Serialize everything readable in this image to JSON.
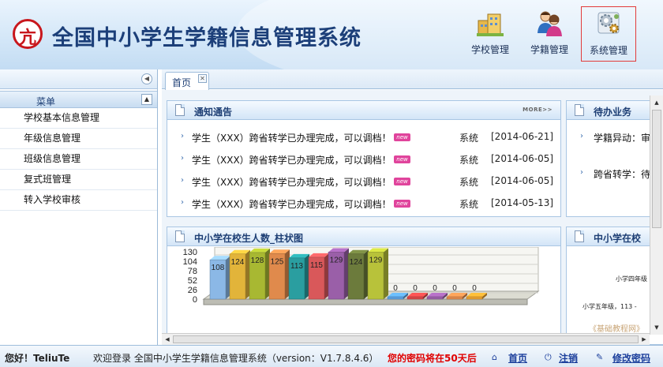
{
  "header": {
    "title": "全国中小学生学籍信息管理系统",
    "logo_glyph": "亢",
    "nav": [
      {
        "label": "学校管理",
        "icon": "school-buildings-icon"
      },
      {
        "label": "学籍管理",
        "icon": "students-icon"
      },
      {
        "label": "系统管理",
        "icon": "system-gears-icon"
      }
    ]
  },
  "sidebar": {
    "menu_title": "菜单",
    "items": [
      "学校基本信息管理",
      "年级信息管理",
      "班级信息管理",
      "复式班管理",
      "转入学校审核"
    ]
  },
  "tabs": [
    {
      "label": "首页"
    }
  ],
  "notice": {
    "title": "通知通告",
    "more": "MORE>>",
    "items": [
      {
        "text": "学生（XXX）跨省转学已办理完成，可以调档！",
        "badge": "new",
        "source": "系统",
        "date": "[2014-06-21]"
      },
      {
        "text": "学生（XXX）跨省转学已办理完成，可以调档！",
        "badge": "new",
        "source": "系统",
        "date": "[2014-06-05]"
      },
      {
        "text": "学生（XXX）跨省转学已办理完成，可以调档！",
        "badge": "new",
        "source": "系统",
        "date": "[2014-06-05]"
      },
      {
        "text": "学生（XXX）跨省转学已办理完成，可以调档！",
        "badge": "new",
        "source": "系统",
        "date": "[2014-05-13]"
      }
    ]
  },
  "pending": {
    "title": "待办业务",
    "items": [
      "学籍异动：审",
      "跨省转学：待"
    ]
  },
  "bar_panel": {
    "title": "中小学在校生人数_柱状图"
  },
  "right_chart": {
    "title": "中小学在校",
    "labels": [
      "小学四年级",
      "小学五年级，113 -"
    ],
    "watermark": "《基础教程网》"
  },
  "chart_data": {
    "type": "bar",
    "title": "中小学在校生人数_柱状图",
    "yticks": [
      0,
      26,
      52,
      78,
      104,
      130
    ],
    "ylim": [
      0,
      130
    ],
    "values": [
      108,
      124,
      128,
      125,
      113,
      115,
      129,
      124,
      129,
      0,
      0,
      0,
      0,
      0
    ],
    "colors": [
      "#8bb8e6",
      "#e2b43a",
      "#a8b832",
      "#e08a4c",
      "#2a9ea0",
      "#d9585a",
      "#9a5fa8",
      "#6c7b3c",
      "#b8c23a",
      "#5aa0e0",
      "#d84848",
      "#9a5fa8",
      "#e08a4c",
      "#e8a030"
    ]
  },
  "footer": {
    "greeting": "您好！TeliuTe",
    "welcome": "欢迎登录 全国中小学生学籍信息管理系统（version：V1.7.8.4.6）",
    "warning": "您的密码将在50天后",
    "links": [
      "首页",
      "注销",
      "修改密码"
    ]
  },
  "colors": {
    "accent": "#1d3e74",
    "warning": "#e00000",
    "badge": "#e0449c"
  }
}
